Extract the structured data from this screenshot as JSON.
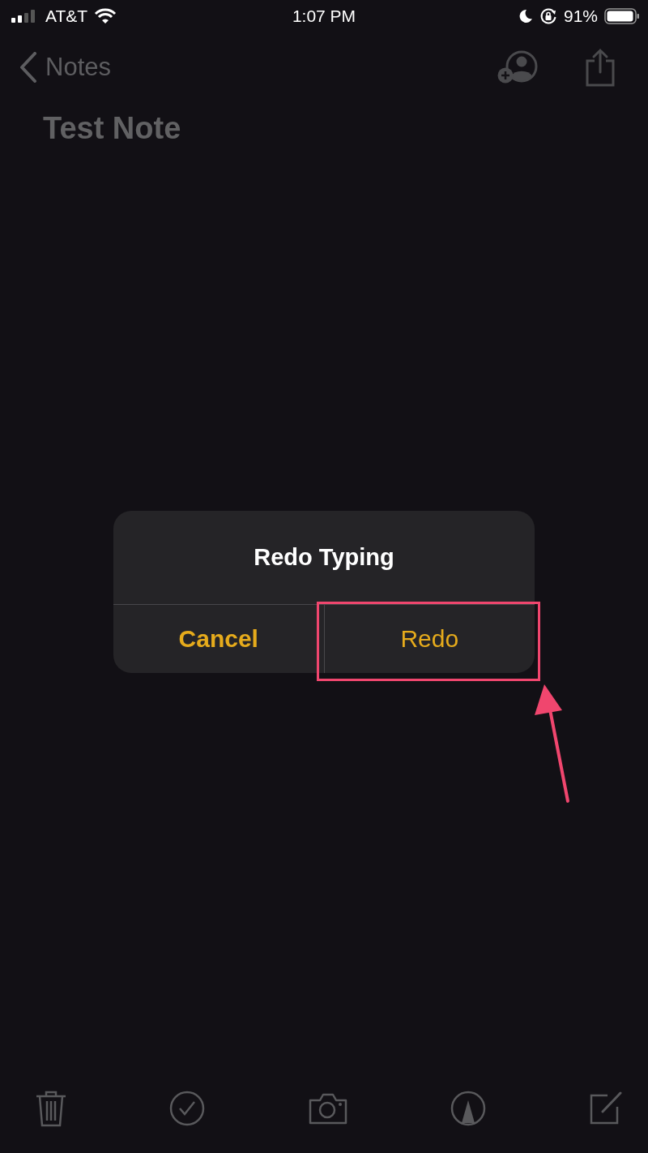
{
  "status_bar": {
    "carrier": "AT&T",
    "time": "1:07 PM",
    "battery": "91%"
  },
  "nav": {
    "back_label": "Notes"
  },
  "note": {
    "title": "Test Note"
  },
  "alert": {
    "title": "Redo Typing",
    "buttons": [
      {
        "label": "Cancel",
        "bold": true,
        "highlighted": false
      },
      {
        "label": "Redo",
        "bold": false,
        "highlighted": true
      }
    ]
  }
}
